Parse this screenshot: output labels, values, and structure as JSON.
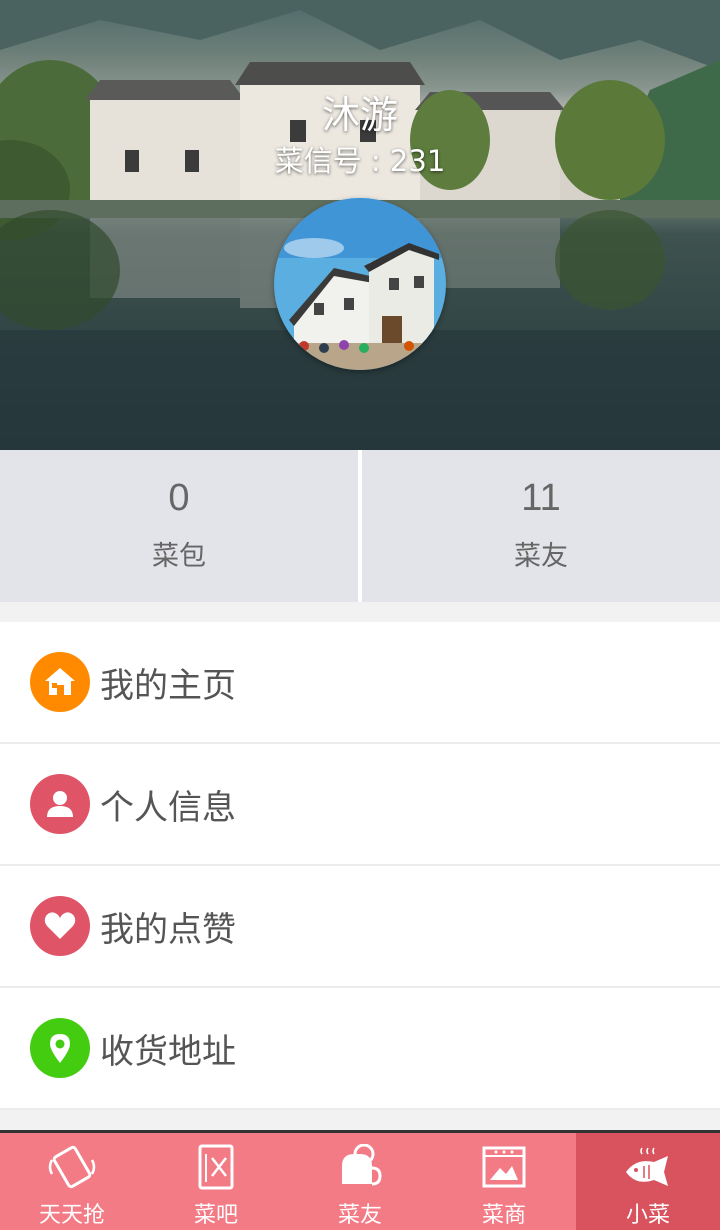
{
  "profile": {
    "name": "沐游",
    "id_text": "菜信号 : 231"
  },
  "stats": [
    {
      "value": "0",
      "label": "菜包"
    },
    {
      "value": "11",
      "label": "菜友"
    }
  ],
  "menu": [
    {
      "label": "我的主页",
      "icon": "home-icon",
      "color": "#ff8a00"
    },
    {
      "label": "个人信息",
      "icon": "person-icon",
      "color": "#e05468"
    },
    {
      "label": "我的点赞",
      "icon": "heart-icon",
      "color": "#e05468"
    },
    {
      "label": "收货地址",
      "icon": "location-pin-icon",
      "color": "#44cc11"
    }
  ],
  "bottom_nav": [
    {
      "label": "天天抢",
      "icon": "phone-vibrate-icon"
    },
    {
      "label": "菜吧",
      "icon": "menu-book-icon"
    },
    {
      "label": "菜友",
      "icon": "chat-bubbles-icon"
    },
    {
      "label": "菜商",
      "icon": "shop-icon"
    },
    {
      "label": "小菜",
      "icon": "fish-icon",
      "active": true
    }
  ],
  "colors": {
    "nav_bg": "#f27b86",
    "nav_active": "#d9535f",
    "stats_bg": "#e3e3ea"
  }
}
